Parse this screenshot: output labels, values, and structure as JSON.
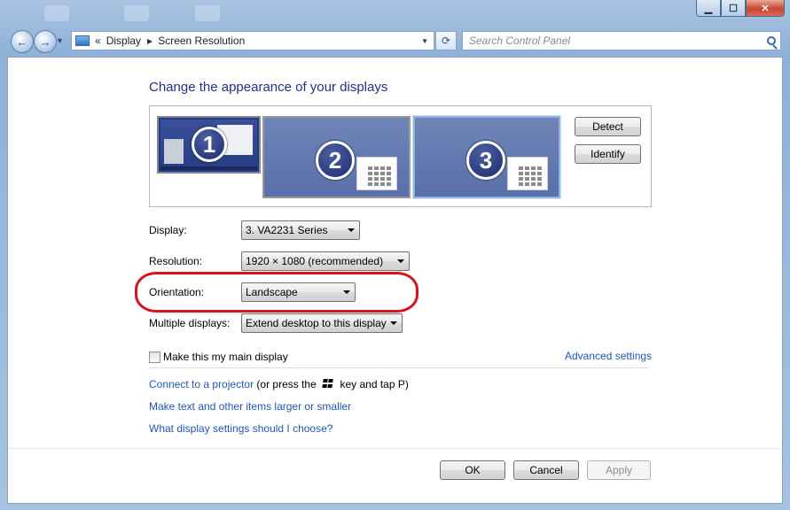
{
  "titlebar": {
    "minimize_icon": "minimize-icon",
    "maximize_icon": "maximize-icon",
    "close_icon": "close-icon"
  },
  "navbar": {
    "back_icon": "back-arrow-icon",
    "forward_icon": "forward-arrow-icon",
    "breadcrumb_overflow": "«",
    "breadcrumb": [
      "Display",
      "Screen Resolution"
    ],
    "search_placeholder": "Search Control Panel"
  },
  "main": {
    "title": "Change the appearance of your displays",
    "monitors": [
      {
        "number": "1",
        "selected": false
      },
      {
        "number": "2",
        "selected": false
      },
      {
        "number": "3",
        "selected": true
      }
    ],
    "detect_label": "Detect",
    "identify_label": "Identify",
    "display": {
      "label": "Display:",
      "value": "3. VA2231 Series"
    },
    "resolution": {
      "label": "Resolution:",
      "value": "1920 × 1080 (recommended)"
    },
    "orientation": {
      "label": "Orientation:",
      "value": "Landscape"
    },
    "multiple": {
      "label": "Multiple displays:",
      "value": "Extend desktop to this display"
    },
    "main_display_label": "Make this my main display",
    "main_display_checked": false,
    "advanced_link": "Advanced settings",
    "projector_link": "Connect to a projector",
    "projector_pre": "(or press the",
    "projector_post": "key and tap P)",
    "text_size_link": "Make text and other items larger or smaller",
    "help_link": "What display settings should I choose?"
  },
  "footer": {
    "ok_label": "OK",
    "cancel_label": "Cancel",
    "apply_label": "Apply"
  },
  "colors": {
    "highlight": "#d6141b",
    "link": "#1e58b0",
    "title": "#1e3287"
  }
}
